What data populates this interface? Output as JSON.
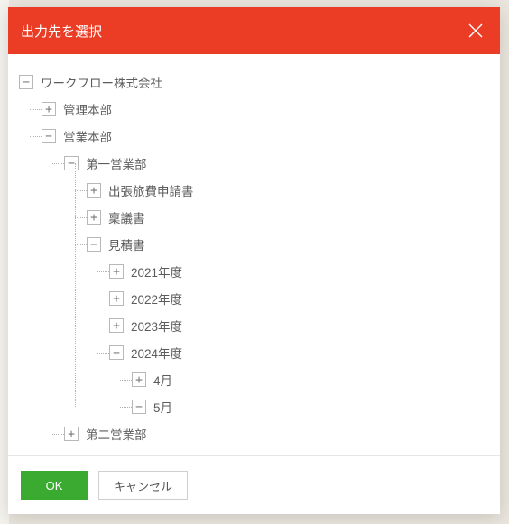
{
  "dialog": {
    "title": "出力先を選択",
    "ok_label": "OK",
    "cancel_label": "キャンセル"
  },
  "icons": {
    "expand": "+",
    "collapse": "−"
  },
  "tree": [
    {
      "label": "ワークフロー株式会社",
      "expanded": true,
      "children": [
        {
          "label": "管理本部",
          "expanded": false,
          "children": []
        },
        {
          "label": "営業本部",
          "expanded": true,
          "children": [
            {
              "label": "第一営業部",
              "expanded": true,
              "children": [
                {
                  "label": "出張旅費申請書",
                  "expanded": false,
                  "children": []
                },
                {
                  "label": "稟議書",
                  "expanded": false,
                  "children": []
                },
                {
                  "label": "見積書",
                  "expanded": true,
                  "children": [
                    {
                      "label": "2021年度",
                      "expanded": false,
                      "children": []
                    },
                    {
                      "label": "2022年度",
                      "expanded": false,
                      "children": []
                    },
                    {
                      "label": "2023年度",
                      "expanded": false,
                      "children": []
                    },
                    {
                      "label": "2024年度",
                      "expanded": true,
                      "children": [
                        {
                          "label": "4月",
                          "expanded": false,
                          "children": []
                        },
                        {
                          "label": "5月",
                          "expanded": true,
                          "children": []
                        }
                      ]
                    }
                  ]
                }
              ]
            },
            {
              "label": "第二営業部",
              "expanded": false,
              "children": []
            }
          ]
        }
      ]
    }
  ]
}
